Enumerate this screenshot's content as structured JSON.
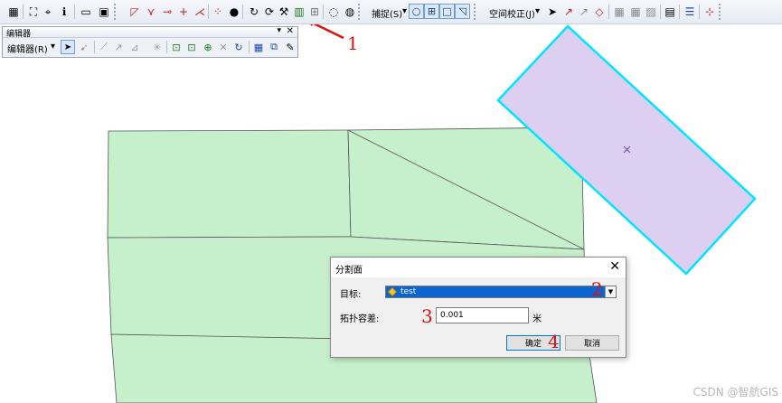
{
  "toolbar": {
    "snapping_label": "捕捉(S)",
    "spatial_adjust_label": "空间校正(J)"
  },
  "editor": {
    "title": "编辑器",
    "menu_label": "编辑器(R)"
  },
  "dialog": {
    "title": "分割面",
    "target_label": "目标:",
    "target_value": "test",
    "tolerance_label": "拓扑容差:",
    "tolerance_value": "0.001",
    "tolerance_unit": "米",
    "ok_label": "确定",
    "cancel_label": "取消"
  },
  "annotations": {
    "n1": "1",
    "n2": "2",
    "n3": "3",
    "n4": "4"
  },
  "watermark": "CSDN @智航GIS",
  "colors": {
    "polygon_fill": "#c6efcb",
    "selected_fill": "#dccff2",
    "selected_outline": "#00e5ff",
    "annotation": "#e01010",
    "combo_highlight": "#0a64d2"
  },
  "icons": {
    "split_polygon_tool": "split-polygon-icon",
    "selected_feature_center": "x-mark-icon"
  }
}
